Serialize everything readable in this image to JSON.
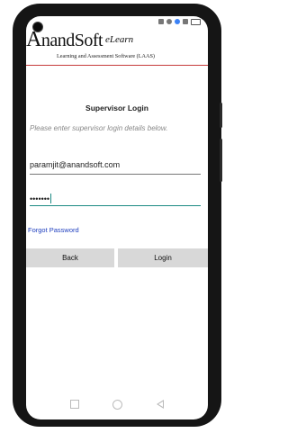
{
  "status_bar": {
    "time": "",
    "icons": [
      "sim-icon",
      "wifi-icon",
      "bluetooth-icon",
      "battery-icon"
    ]
  },
  "header": {
    "logo_initial": "A",
    "logo_text": "nandSoft",
    "logo_sub": "eLearn",
    "tagline": "Learning and Assessment Software (LAAS)",
    "accent_color": "#c63b3b"
  },
  "login": {
    "title": "Supervisor Login",
    "subtitle": "Please enter supervisor login details below.",
    "email_value": "paramjit@anandsoft.com",
    "password_masked": "•••••••",
    "forgot_label": "Forgot Password",
    "back_label": "Back",
    "login_label": "Login",
    "focus_color": "#1c8a83"
  }
}
